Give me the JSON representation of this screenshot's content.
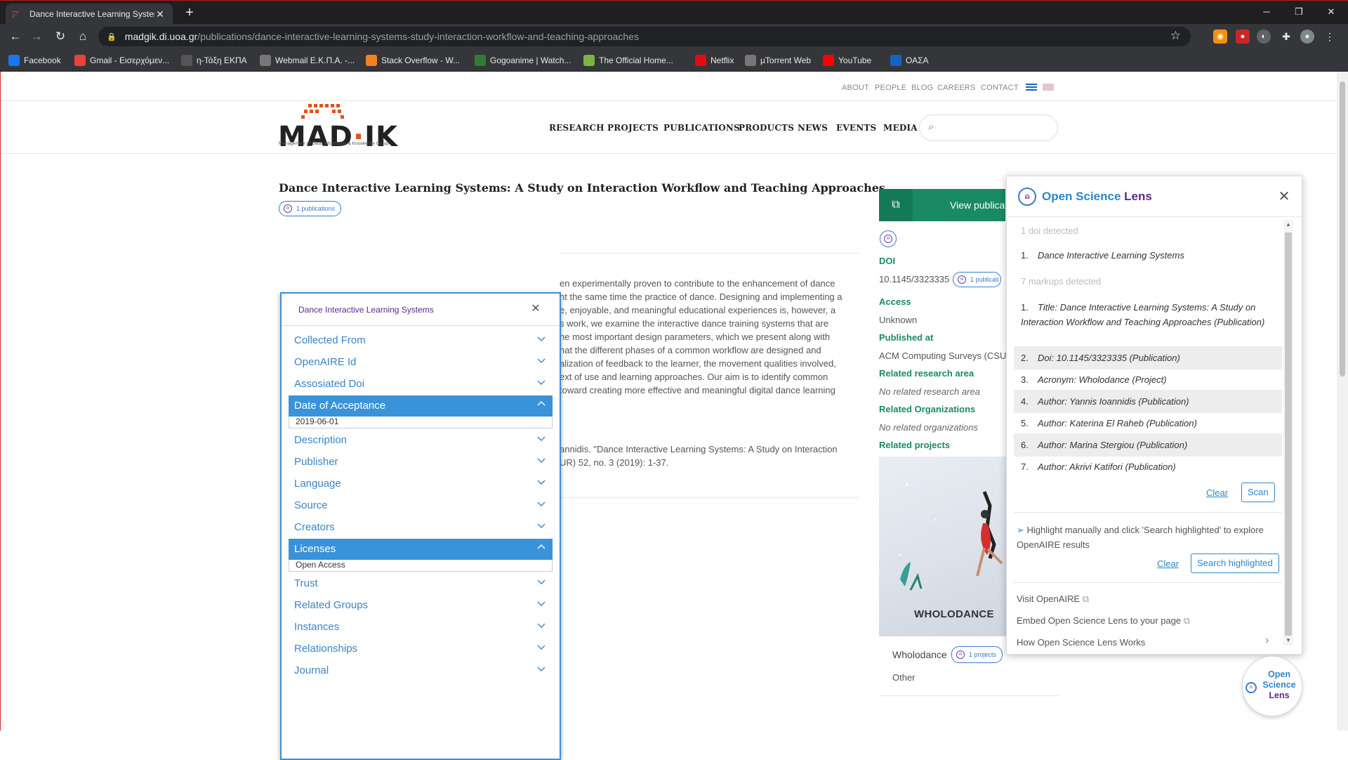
{
  "browser": {
    "tab_title": "Dance Interactive Learning Systen",
    "new_tab": "+",
    "url_host": "madgik.di.uoa.gr",
    "url_path": "/publications/dance-interactive-learning-systems-study-interaction-workflow-and-teaching-approaches",
    "bookmarks": [
      {
        "label": "Facebook",
        "icon": "facebook-icon",
        "color": "#1877f2"
      },
      {
        "label": "Gmail - Εισερχόμεν...",
        "icon": "gmail-icon",
        "color": "#ea4335"
      },
      {
        "label": "η-Τάξη ΕΚΠΑ",
        "icon": "eclass-icon",
        "color": "#555"
      },
      {
        "label": "Webmail Ε.Κ.Π.Α. -...",
        "icon": "globe-icon",
        "color": "#777"
      },
      {
        "label": "Stack Overflow - W...",
        "icon": "stackoverflow-icon",
        "color": "#f48024"
      },
      {
        "label": "Gogoanime | Watch...",
        "icon": "gogoanime-icon",
        "color": "#2e7d32"
      },
      {
        "label": "The Official Home...",
        "icon": "leaf-icon",
        "color": "#7cb342"
      },
      {
        "label": "Netflix",
        "icon": "netflix-icon",
        "color": "#e50914"
      },
      {
        "label": "µTorrent Web",
        "icon": "utorrent-icon",
        "color": "#777"
      },
      {
        "label": "YouTube",
        "icon": "youtube-icon",
        "color": "#ff0000"
      },
      {
        "label": "ΟΑΣΑ",
        "icon": "oasa-icon",
        "color": "#1565c0"
      }
    ]
  },
  "site": {
    "toplinks": [
      "ABOUT",
      "PEOPLE",
      "BLOG",
      "CAREERS",
      "CONTACT"
    ],
    "logo_text": "MAD·IK",
    "logo_sub": "Management of Data, Information & Knowledge Group",
    "nav": [
      "RESEARCH",
      "PROJECTS",
      "PUBLICATIONS",
      "PRODUCTS",
      "NEWS",
      "EVENTS",
      "MEDIA"
    ]
  },
  "publication": {
    "title": "Dance Interactive Learning Systems: A Study on Interaction Workflow and Teaching Approaches",
    "badge": "1 publications",
    "abstract_lines": [
      "en experimentally proven to contribute to the enhancement of dance",
      "nt the same time the practice of dance. Designing and implementing a",
      "e, enjoyable, and meaningful educational experiences is, however, a",
      "s work, we examine the interactive dance training systems that are",
      "he most important design parameters, which we present along with",
      "hat the different phases of a common workflow are designed and",
      "alization of feedback to the learner, the movement qualities involved,",
      "ext of use and learning approaches. Our aim is to identify common",
      " toward creating more effective and meaningful digital dance learning"
    ],
    "citation_lines": [
      "annidis. \"Dance Interactive Learning Systems: A Study on Interaction",
      "UR) 52, no. 3 (2019): 1-37."
    ]
  },
  "sidebar": {
    "view_button": "View publicat",
    "doi_label": "DOI",
    "doi_value": "10.1145/3323335",
    "doi_badge": "1 publicati",
    "access_label": "Access",
    "access_value": "Unknown",
    "published_label": "Published at",
    "published_value": "ACM Computing Surveys (CSU",
    "research_label": "Related research area",
    "research_value": "No related research area",
    "orgs_label": "Related Organizations",
    "orgs_value": "No related organizations",
    "projects_label": "Related projects",
    "project_image_text": "WHOLODANCE",
    "project_name": "Wholodance",
    "project_badge": "1 projects",
    "project_type": "Other"
  },
  "meta_popup": {
    "title": "Dance Interactive Learning Systems",
    "sections": [
      {
        "label": "Collected From",
        "open": false
      },
      {
        "label": "OpenAIRE Id",
        "open": false
      },
      {
        "label": "Assosiated Doi",
        "open": false
      },
      {
        "label": "Date of Acceptance",
        "open": true,
        "value": "2019-06-01"
      },
      {
        "label": "Description",
        "open": false
      },
      {
        "label": "Publisher",
        "open": false
      },
      {
        "label": "Language",
        "open": false
      },
      {
        "label": "Source",
        "open": false
      },
      {
        "label": "Creators",
        "open": false
      },
      {
        "label": "Licenses",
        "open": true,
        "value": "Open Access"
      },
      {
        "label": "Trust",
        "open": false
      },
      {
        "label": "Related Groups",
        "open": false
      },
      {
        "label": "Instances",
        "open": false
      },
      {
        "label": "Relationships",
        "open": false
      },
      {
        "label": "Journal",
        "open": false
      }
    ]
  },
  "osl": {
    "brand_1": "Open Science ",
    "brand_2": "Lens",
    "doi_count": "1 doi detected",
    "dois": [
      "Dance Interactive Learning Systems"
    ],
    "markup_count": "7 markups detected",
    "markups": [
      "Title: Dance Interactive Learning Systems: A Study on Interaction Workflow and Teaching Approaches (Publication)",
      "Doi: 10.1145/3323335 (Publication)",
      "Acronym: Wholodance (Project)",
      "Author: Yannis Ioannidis (Publication)",
      "Author: Katerina El Raheb (Publication)",
      "Author: Marina Stergiou (Publication)",
      "Author: Akrivi Katifori (Publication)"
    ],
    "clear": "Clear",
    "scan": "Scan",
    "hint": "Highlight manually and click 'Search highlighted' to explore OpenAIRE results",
    "clear2": "Clear",
    "search_highlighted": "Search highlighted",
    "visit": "Visit OpenAIRE",
    "embed": "Embed Open Science Lens to your page",
    "how": "How Open Science Lens Works",
    "fab_1": "Open Science",
    "fab_2": "Lens"
  }
}
